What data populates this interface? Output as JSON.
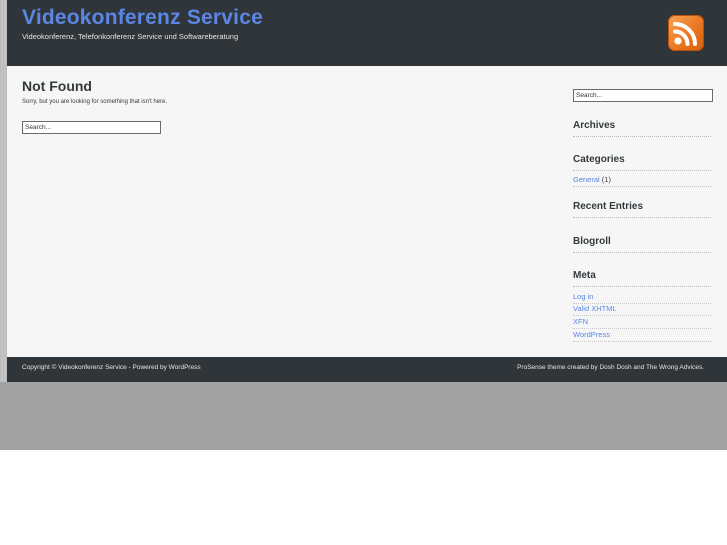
{
  "header": {
    "title": "Videokonferenz Service",
    "description": "Videokonferenz, Telefonkonferenz Service und Softwareberatung",
    "feed_icon": "rss-icon"
  },
  "main": {
    "heading": "Not Found",
    "message": "Sorry, but you are looking for something that isn't here.",
    "search_value": "Search..."
  },
  "sidebar": {
    "search_value": "Search...",
    "archives_title": "Archives",
    "categories_title": "Categories",
    "categories": [
      {
        "label": "General",
        "count": "(1)"
      }
    ],
    "recent_title": "Recent Entries",
    "blogroll_title": "Blogroll",
    "meta_title": "Meta",
    "meta_links": [
      "Log in",
      "Valid XHTML",
      "XFN",
      "WordPress"
    ]
  },
  "footer": {
    "left": "Copyright © Videokonferenz Service - Powered by WordPress",
    "right": "ProSense theme created by Dosh Dosh and The Wrong Advices."
  },
  "colors": {
    "header_bg": "#2f3538",
    "title_blue": "#5b86e5",
    "link_blue": "#5b86e5",
    "content_bg": "#f6f6f6",
    "rss_orange": "#e9741d"
  }
}
